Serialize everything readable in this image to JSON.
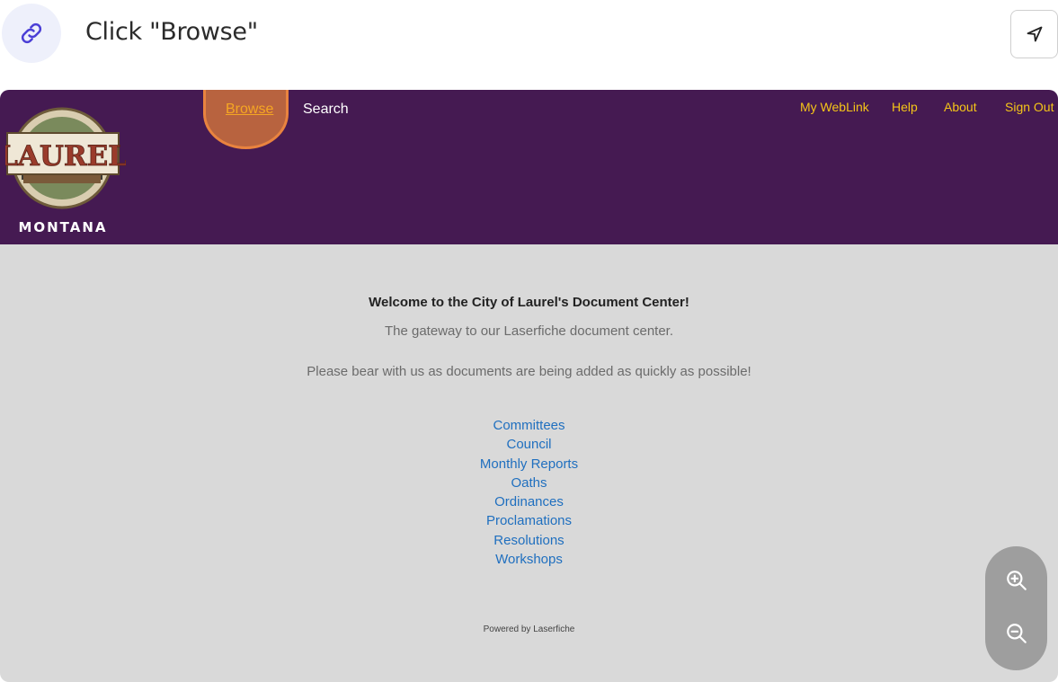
{
  "instruction": {
    "text": "Click \"Browse\"",
    "link_icon": "link-icon",
    "nav_icon": "navigation-arrow-icon"
  },
  "site": {
    "logo": {
      "name": "laurel-montana-seal",
      "text_top": "LAUREL",
      "text_bottom": "MONTANA"
    },
    "nav_left": [
      {
        "label": "Browse",
        "active": true
      },
      {
        "label": "Search",
        "active": false
      }
    ],
    "nav_right": [
      {
        "label": "My WebLink"
      },
      {
        "label": "Help"
      },
      {
        "label": "About"
      },
      {
        "label": "Sign Out"
      }
    ],
    "colors": {
      "header": "#451a52",
      "link": "#1f6fbf",
      "highlight": "#e9833f",
      "nav_right": "#f5c518"
    }
  },
  "content": {
    "welcome": "Welcome to the City of Laurel's Document Center!",
    "gateway": "The gateway to our Laserfiche document center.",
    "bear": "Please bear with us as documents are being added as quickly as possible!",
    "folders": [
      "Committees",
      "Council",
      "Monthly Reports",
      "Oaths",
      "Ordinances",
      "Proclamations",
      "Resolutions",
      "Workshops"
    ],
    "powered_by": "Powered by Laserfiche"
  },
  "zoom": {
    "in_icon": "zoom-in-icon",
    "out_icon": "zoom-out-icon"
  }
}
